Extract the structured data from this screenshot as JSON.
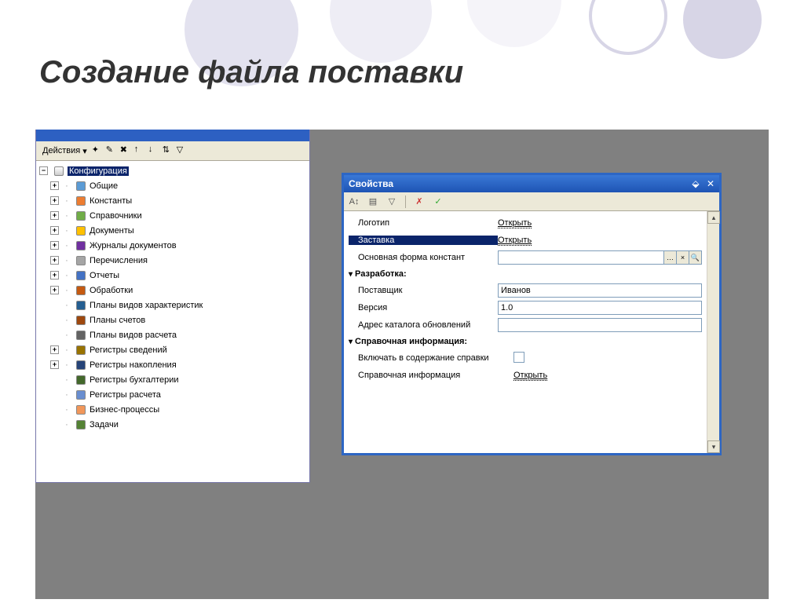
{
  "slide_title": "Создание файла поставки",
  "left_panel": {
    "actions_label": "Действия",
    "root_label": "Конфигурация",
    "items": [
      {
        "label": "Общие",
        "expandable": true
      },
      {
        "label": "Константы",
        "expandable": true
      },
      {
        "label": "Справочники",
        "expandable": true
      },
      {
        "label": "Документы",
        "expandable": true
      },
      {
        "label": "Журналы документов",
        "expandable": true
      },
      {
        "label": "Перечисления",
        "expandable": true
      },
      {
        "label": "Отчеты",
        "expandable": true
      },
      {
        "label": "Обработки",
        "expandable": true
      },
      {
        "label": "Планы видов характеристик",
        "expandable": false
      },
      {
        "label": "Планы счетов",
        "expandable": false
      },
      {
        "label": "Планы видов расчета",
        "expandable": false
      },
      {
        "label": "Регистры сведений",
        "expandable": true
      },
      {
        "label": "Регистры накопления",
        "expandable": true
      },
      {
        "label": "Регистры бухгалтерии",
        "expandable": false
      },
      {
        "label": "Регистры расчета",
        "expandable": false
      },
      {
        "label": "Бизнес-процессы",
        "expandable": false
      },
      {
        "label": "Задачи",
        "expandable": false
      }
    ]
  },
  "props": {
    "title": "Свойства",
    "logo_label": "Логотип",
    "open_link": "Открыть",
    "splash_label": "Заставка",
    "constants_form_label": "Основная форма констант",
    "dev_section": "Разработка:",
    "supplier_label": "Поставщик",
    "supplier_value": "Иванов",
    "version_label": "Версия",
    "version_value": "1.0",
    "update_addr_label": "Адрес каталога обновлений",
    "update_addr_value": "",
    "help_section": "Справочная информация:",
    "include_help_label": "Включать в содержание справки",
    "help_info_label": "Справочная информация"
  }
}
